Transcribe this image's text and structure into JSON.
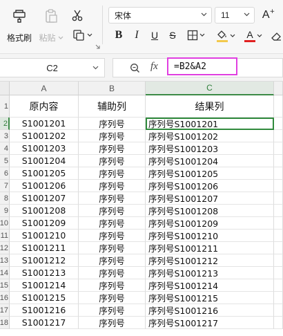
{
  "ribbon": {
    "format_painter_label": "格式刷",
    "paste_label": "粘贴",
    "font_name": "宋体",
    "font_size": "11",
    "icons": {
      "format_painter": "format-painter-icon",
      "paste": "paste-icon",
      "cut": "scissors-icon",
      "copy": "copy-icon",
      "font_grow": "font-grow-icon",
      "bold": "bold-icon",
      "italic": "italic-icon",
      "underline": "underline-icon",
      "strikethrough": "strikethrough-icon",
      "borders": "borders-icon",
      "fill": "fill-color-icon",
      "font_color": "font-color-icon",
      "clear": "eraser-icon"
    },
    "bold_glyph": "B",
    "italic_glyph": "I",
    "underline_glyph": "U",
    "strike_glyph": "S",
    "fontcolor_glyph": "A",
    "grow_glyph": "A",
    "fill_color": "#f2c94c",
    "font_color": "#e02020"
  },
  "formula_bar": {
    "name_box": "C2",
    "fx_label": "fx",
    "formula": "=B2&A2",
    "highlight_color": "#e03ee0"
  },
  "sheet": {
    "columns": [
      "A",
      "B",
      "C"
    ],
    "header_row": {
      "row_label": "1",
      "cells": [
        "原内容",
        "辅助列",
        "结果列"
      ]
    },
    "rows": [
      {
        "row_label": "2",
        "a": "S1001201",
        "b": "序列号",
        "c": "序列号S1001201"
      },
      {
        "row_label": "3",
        "a": "S1001202",
        "b": "序列号",
        "c": "序列号S1001202"
      },
      {
        "row_label": "4",
        "a": "S1001203",
        "b": "序列号",
        "c": "序列号S1001203"
      },
      {
        "row_label": "5",
        "a": "S1001204",
        "b": "序列号",
        "c": "序列号S1001204"
      },
      {
        "row_label": "6",
        "a": "S1001205",
        "b": "序列号",
        "c": "序列号S1001205"
      },
      {
        "row_label": "7",
        "a": "S1001206",
        "b": "序列号",
        "c": "序列号S1001206"
      },
      {
        "row_label": "8",
        "a": "S1001207",
        "b": "序列号",
        "c": "序列号S1001207"
      },
      {
        "row_label": "9",
        "a": "S1001208",
        "b": "序列号",
        "c": "序列号S1001208"
      },
      {
        "row_label": "10",
        "a": "S1001209",
        "b": "序列号",
        "c": "序列号S1001209"
      },
      {
        "row_label": "11",
        "a": "S1001210",
        "b": "序列号",
        "c": "序列号S1001210"
      },
      {
        "row_label": "12",
        "a": "S1001211",
        "b": "序列号",
        "c": "序列号S1001211"
      },
      {
        "row_label": "13",
        "a": "S1001212",
        "b": "序列号",
        "c": "序列号S1001212"
      },
      {
        "row_label": "14",
        "a": "S1001213",
        "b": "序列号",
        "c": "序列号S1001213"
      },
      {
        "row_label": "15",
        "a": "S1001214",
        "b": "序列号",
        "c": "序列号S1001214"
      },
      {
        "row_label": "16",
        "a": "S1001215",
        "b": "序列号",
        "c": "序列号S1001215"
      },
      {
        "row_label": "17",
        "a": "S1001216",
        "b": "序列号",
        "c": "序列号S1001216"
      },
      {
        "row_label": "18",
        "a": "S1001217",
        "b": "序列号",
        "c": "序列号S1001217"
      }
    ],
    "selected_cell": "C2",
    "selection_color": "#2f8a3c"
  }
}
